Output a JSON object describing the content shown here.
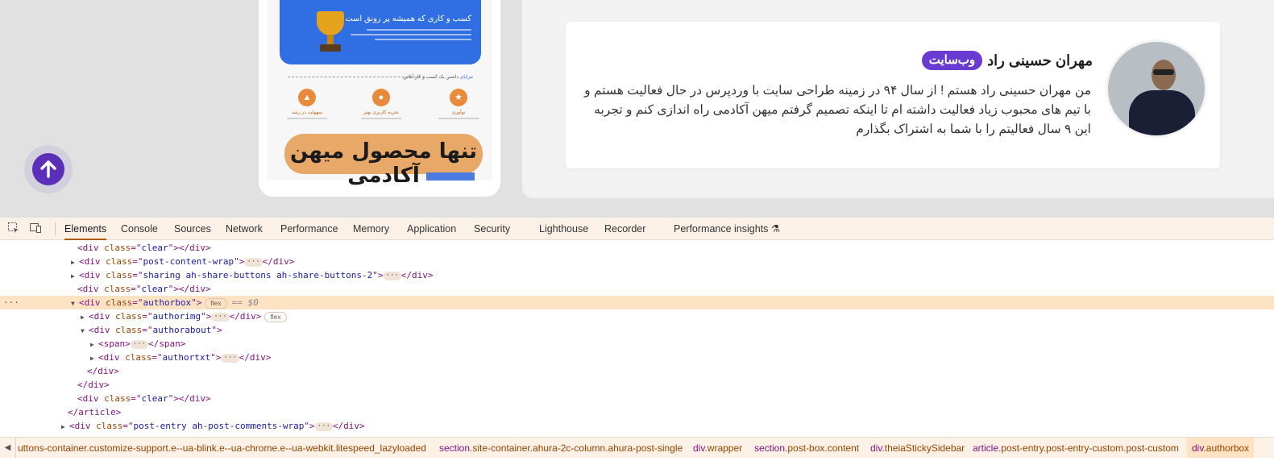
{
  "page": {
    "promo": {
      "title": "کسب و کاری که همیشه پر رونق است ...",
      "subtitle_prefix": "مزایای",
      "subtitle": "داشتن یک کسب و کار آنلاین",
      "features": [
        {
          "label": "نوآوری",
          "icon": "star-icon"
        },
        {
          "label": "تجربه کاربری بهتر",
          "icon": "user-icon"
        },
        {
          "label": "سهولت در رشد",
          "icon": "chart-icon"
        }
      ],
      "banner_text": "تنها محصول میهن آکادمی"
    },
    "author": {
      "name": "مهران حسینی راد",
      "badge": "وب‌سایت",
      "bio": "من مهران حسینی راد هستم ! از سال ۹۴ در زمینه طراحی سایت با وردپرس در حال فعالیت هستم و با تیم های محبوب زیاد فعالیت داشته ام تا اینکه تصمیم گرفتم میهن آکادمی راه اندازی کنم و تجربه این ۹ سال فعالیتم را با شما به اشتراک بگذارم"
    },
    "scroll_top_icon": "arrow-up-icon"
  },
  "devtools": {
    "tabs": [
      {
        "label": "Elements",
        "active": true
      },
      {
        "label": "Console"
      },
      {
        "label": "Sources"
      },
      {
        "label": "Network"
      },
      {
        "label": "Performance"
      },
      {
        "label": "Memory"
      },
      {
        "label": "Application"
      },
      {
        "label": "Security"
      },
      {
        "label": "Lighthouse"
      },
      {
        "label": "Recorder"
      },
      {
        "label": "Performance insights"
      }
    ],
    "dom_lines": [
      {
        "tag": "div",
        "cls": "clear",
        "close": true
      },
      {
        "tag": "div",
        "cls": "post-content-wrap",
        "collapsed": true
      },
      {
        "tag": "div",
        "cls": "sharing ah-share-buttons ah-share-buttons-2",
        "collapsed": true
      },
      {
        "tag": "div",
        "cls": "clear",
        "close": true
      },
      {
        "tag": "div",
        "cls": "authorbox",
        "badge": "flex",
        "selected": true,
        "suffix": "== $0"
      },
      {
        "tag": "div",
        "cls": "authorimg",
        "collapsed": true,
        "badge": "flex"
      },
      {
        "tag": "div",
        "cls": "authorabout",
        "open": true
      },
      {
        "tag": "span",
        "collapsed": true
      },
      {
        "tag": "div",
        "cls": "authortxt",
        "collapsed": true
      },
      {
        "closing": "div"
      },
      {
        "closing": "div"
      },
      {
        "tag": "div",
        "cls": "clear",
        "close": true
      },
      {
        "closing": "article"
      },
      {
        "tag": "div",
        "cls": "post-entry ah-post-comments-wrap",
        "collapsed": true
      }
    ],
    "breadcrumbs": [
      {
        "tag": "",
        "cls": "uttons-container.customize-support.e--ua-blink.e--ua-chrome.e--ua-webkit.litespeed_lazyloaded"
      },
      {
        "tag": "section",
        "cls": ".site-container.ahura-2c-column.ahura-post-single"
      },
      {
        "tag": "div",
        "cls": ".wrapper"
      },
      {
        "tag": "section",
        "cls": ".post-box.content"
      },
      {
        "tag": "div",
        "cls": ".theiaStickySidebar"
      },
      {
        "tag": "article",
        "cls": ".post-entry.post-entry-custom.post-custom"
      },
      {
        "tag": "div",
        "cls": ".authorbox",
        "active": true
      }
    ]
  }
}
